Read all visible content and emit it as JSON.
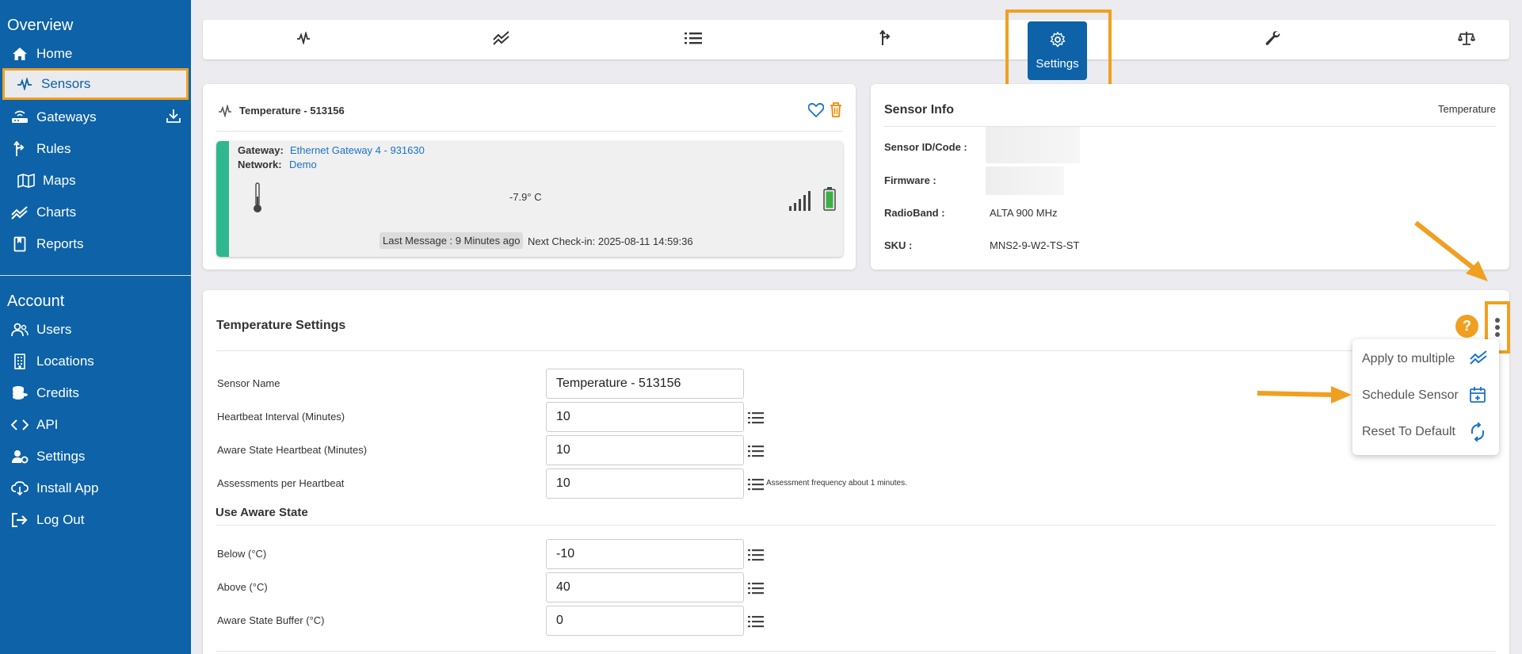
{
  "sidebar": {
    "overview_heading": "Overview",
    "account_heading": "Account",
    "nav": [
      {
        "label": "Home",
        "icon": "home-icon"
      },
      {
        "label": "Sensors",
        "icon": "pulse-icon"
      },
      {
        "label": "Gateways",
        "icon": "router-icon"
      },
      {
        "label": "Rules",
        "icon": "rules-icon"
      },
      {
        "label": "Maps",
        "icon": "map-icon"
      },
      {
        "label": "Charts",
        "icon": "chart-icon"
      },
      {
        "label": "Reports",
        "icon": "report-icon"
      }
    ],
    "account": [
      {
        "label": "Users",
        "icon": "users-icon"
      },
      {
        "label": "Locations",
        "icon": "building-icon"
      },
      {
        "label": "Credits",
        "icon": "coins-icon"
      },
      {
        "label": "API",
        "icon": "code-icon"
      },
      {
        "label": "Settings",
        "icon": "user-gear-icon"
      },
      {
        "label": "Install App",
        "icon": "cloud-download-icon"
      },
      {
        "label": "Log Out",
        "icon": "logout-icon"
      }
    ]
  },
  "toolbar": {
    "settings_label": "Settings"
  },
  "sensor_card": {
    "title": "Temperature - 513156",
    "gateway_label": "Gateway:",
    "gateway_value": "Ethernet Gateway 4 - 931630",
    "network_label": "Network:",
    "network_value": "Demo",
    "reading": "-7.9° C",
    "last_message": "Last Message : 9 Minutes ago",
    "next_checkin": "Next Check-in: 2025-08-11  14:59:36"
  },
  "info_card": {
    "title": "Sensor Info",
    "type": "Temperature",
    "sensor_id_label": "Sensor ID/Code :",
    "firmware_label": "Firmware :",
    "radioband_label": "RadioBand :",
    "radioband_value": "ALTA 900 MHz",
    "sku_label": "SKU :",
    "sku_value": "MNS2-9-W2-TS-ST"
  },
  "settings": {
    "title": "Temperature Settings",
    "help": "?",
    "fields": [
      {
        "label": "Sensor Name",
        "value": "Temperature - 513156"
      },
      {
        "label": "Heartbeat Interval (Minutes)",
        "value": "10"
      },
      {
        "label": "Aware State Heartbeat (Minutes)",
        "value": "10"
      },
      {
        "label": "Assessments per Heartbeat",
        "value": "10"
      }
    ],
    "assessment_hint": "Assessment frequency about 1 minutes.",
    "aware_heading": "Use Aware State",
    "aware_fields": [
      {
        "label": "Below (°C)",
        "value": "-10"
      },
      {
        "label": "Above (°C)",
        "value": "40"
      },
      {
        "label": "Aware State Buffer (°C)",
        "value": "0"
      }
    ]
  },
  "menu": {
    "items": [
      "Apply to multiple",
      "Schedule Sensor",
      "Reset To Default"
    ]
  },
  "colors": {
    "sidebar": "#0d62a8",
    "highlight": "#f0a020",
    "status_bar": "#2fb88f",
    "link": "#1a73c8"
  }
}
